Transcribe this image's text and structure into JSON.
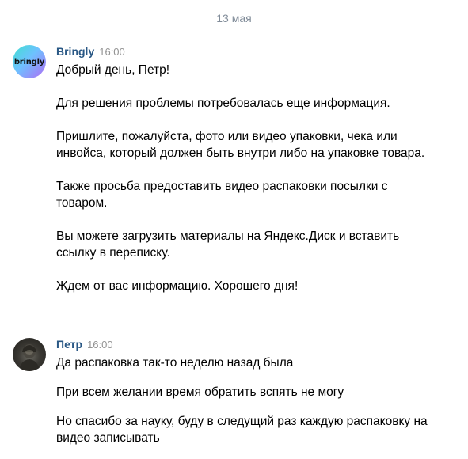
{
  "date_separator": "13 мая",
  "messages": [
    {
      "author": "Bringly",
      "time": "16:00",
      "avatar_text": "bringly",
      "paragraphs": [
        "Добрый день, Петр!",
        "Для решения проблемы потребовалась еще информация.",
        "Пришлите, пожалуйста, фото или видео упаковки, чека или инвойса, который должен быть внутри либо на упаковке товара.",
        "Также просьба предоставить видео распаковки посылки с товаром.",
        "Вы можете загрузить материалы на Яндекс.Диск и вставить ссылку в переписку.",
        "Ждем от вас информацию. Хорошего дня!"
      ]
    },
    {
      "author": "Петр",
      "time": "16:00",
      "paragraphs": [
        "Да распаковка так-то неделю назад была",
        "При всем желании время обратить вспять не могу",
        "Но спасибо за науку, буду в следущий раз каждую распаковку на видео записывать"
      ]
    }
  ],
  "colors": {
    "author": "#2a5885",
    "time": "#939393",
    "date": "#818c99",
    "bringly_gradient": [
      "#3fe0d0",
      "#6ec1ff",
      "#b06cf5"
    ]
  },
  "icons": {
    "bringly_avatar": "bringly-logo-icon",
    "petr_avatar": "user-photo-icon"
  }
}
